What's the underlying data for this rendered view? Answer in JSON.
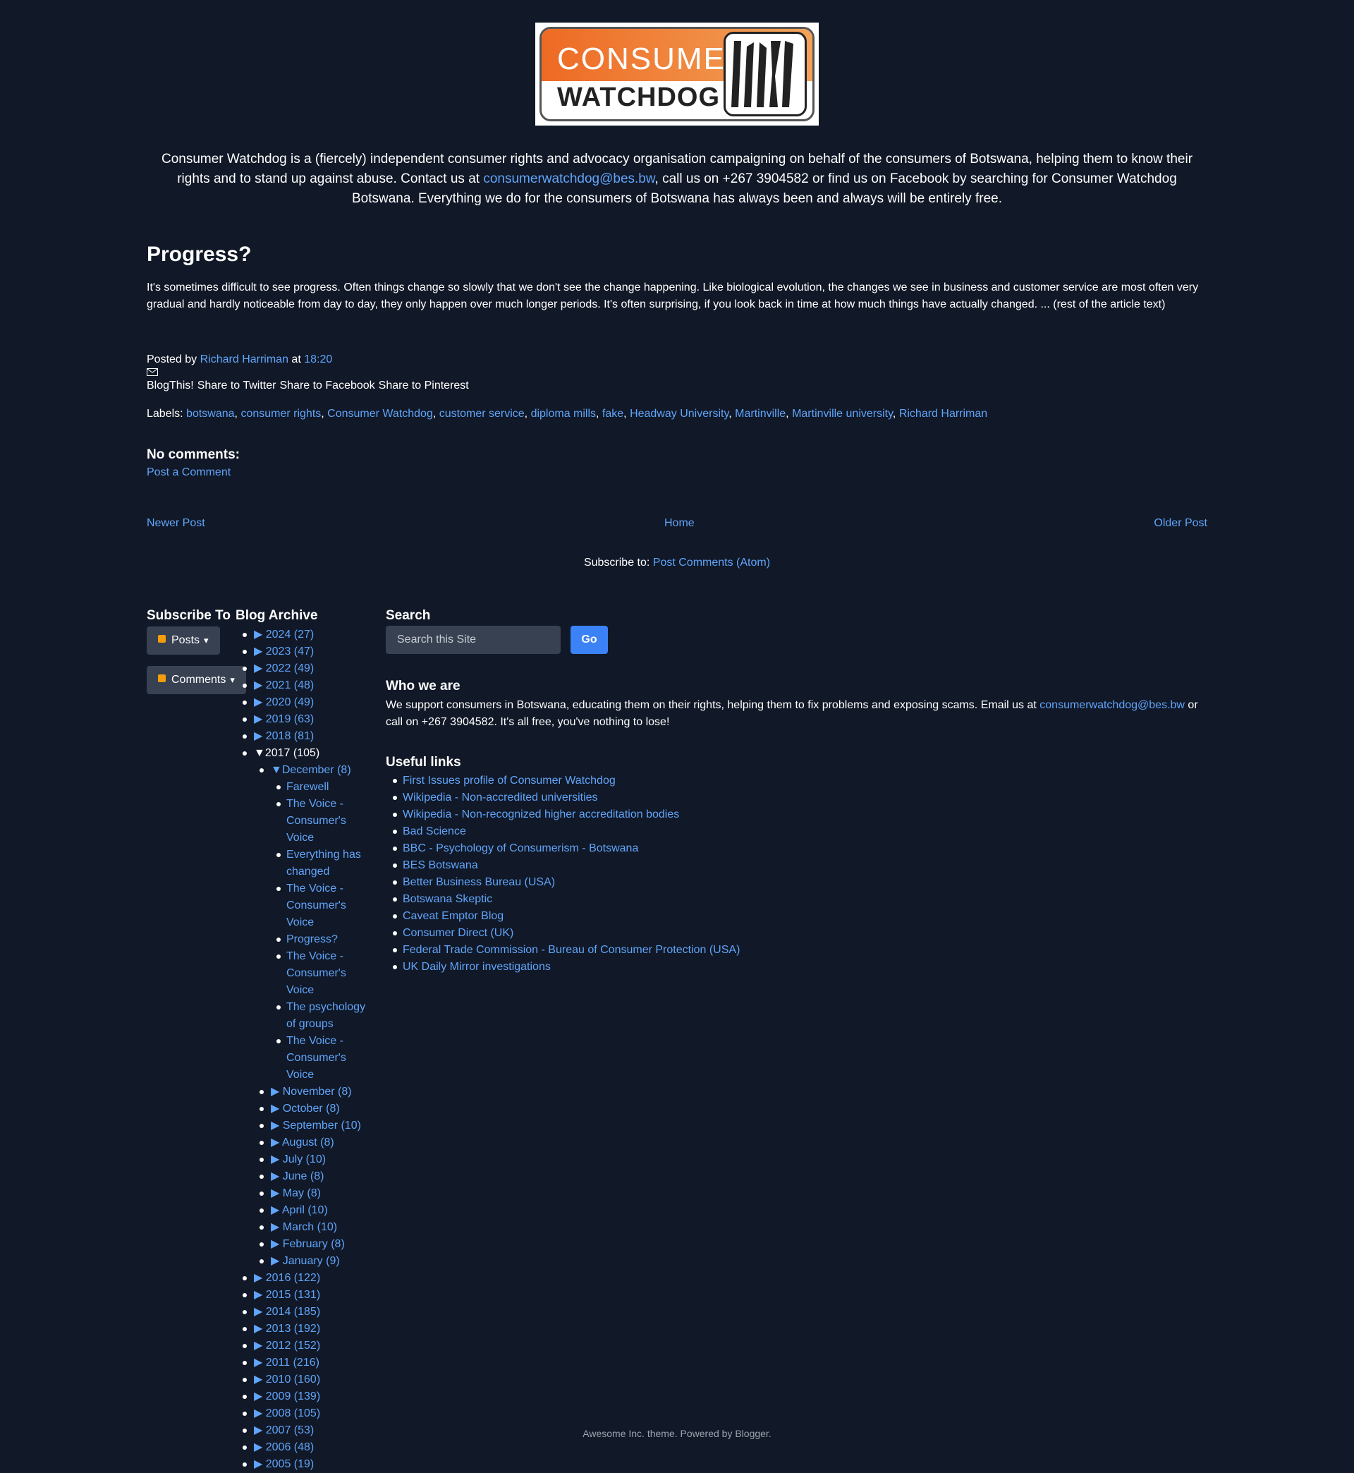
{
  "header": {
    "logo_line1": "CONSUMER",
    "logo_line2": "WATCHDOG",
    "intro_before": "Consumer Watchdog is a (fiercely) independent consumer rights and advocacy organisation campaigning on behalf of the consumers of Botswana, helping them to know their rights and to stand up against abuse. Contact us at ",
    "intro_email": "consumerwatchdog@bes.bw",
    "intro_after": ", call us on +267 3904582 or find us on Facebook by searching for Consumer Watchdog Botswana. Everything we do for the consumers of Botswana has always been and always will be entirely free."
  },
  "post": {
    "title": "Progress?",
    "body": "It's sometimes difficult to see progress. Often things change so slowly that we don't see the change happening. Like biological evolution, the changes we see in business and customer service are most often very gradual and hardly noticeable from day to day, they only happen over much longer periods. It's often surprising, if you look back in time at how much things have actually changed. ... (rest of the article text)",
    "posted_by": "Posted by ",
    "author": "Richard Harriman",
    "at": " at ",
    "time": "18:20",
    "share": [
      "BlogThis!",
      "Share to Twitter",
      "Share to Facebook",
      "Share to Pinterest"
    ],
    "labels_prefix": "Labels: ",
    "labels": [
      "botswana",
      "consumer rights",
      "Consumer Watchdog",
      "customer service",
      "diploma mills",
      "fake",
      "Headway University",
      "Martinville",
      "Martinville university",
      "Richard Harriman"
    ],
    "comments_heading": "No comments:",
    "post_comment": "Post a Comment"
  },
  "nav": {
    "newer": "Newer Post",
    "home": "Home",
    "older": "Older Post",
    "subscribe_prefix": "Subscribe to: ",
    "subscribe_link": "Post Comments (Atom)"
  },
  "subscribe": {
    "title": "Subscribe To",
    "posts": "Posts",
    "comments": "Comments"
  },
  "archive": {
    "title": "Blog Archive",
    "years_before": [
      {
        "label": "2024 (27)"
      },
      {
        "label": "2023 (47)"
      },
      {
        "label": "2022 (49)"
      },
      {
        "label": "2021 (48)"
      },
      {
        "label": "2020 (49)"
      },
      {
        "label": "2019 (63)"
      },
      {
        "label": "2018 (81)"
      }
    ],
    "open_year": "2017 (105)",
    "open_month": "December (8)",
    "december_posts": [
      "Farewell",
      "The Voice - Consumer's Voice",
      "Everything has changed",
      "The Voice - Consumer's Voice",
      "Progress?",
      "The Voice - Consumer's Voice",
      "The psychology of groups",
      "The Voice - Consumer's Voice"
    ],
    "months": [
      "November (8)",
      "October (8)",
      "September (10)",
      "August (8)",
      "July (10)",
      "June (8)",
      "May (8)",
      "April (10)",
      "March (10)",
      "February (8)",
      "January (9)"
    ],
    "years_after": [
      "2016 (122)",
      "2015 (131)",
      "2014 (185)",
      "2013 (192)",
      "2012 (152)",
      "2011 (216)",
      "2010 (160)",
      "2009 (139)",
      "2008 (105)",
      "2007 (53)",
      "2006 (48)",
      "2005 (19)"
    ]
  },
  "search": {
    "title": "Search",
    "placeholder": "Search this Site",
    "button": "Go"
  },
  "who": {
    "title": "Who we are",
    "text_before": "We support consumers in Botswana, educating them on their rights, helping them to fix problems and exposing scams. Email us at ",
    "email": "consumerwatchdog@bes.bw",
    "text_after": " or call on +267 3904582. It's all free, you've nothing to lose!"
  },
  "useful": {
    "title": "Useful links",
    "links": [
      "First Issues profile of Consumer Watchdog",
      "Wikipedia - Non-accredited universities",
      "Wikipedia - Non-recognized higher accreditation bodies",
      "Bad Science",
      "BBC - Psychology of Consumerism - Botswana",
      "BES Botswana",
      "Better Business Bureau (USA)",
      "Botswana Skeptic",
      "Caveat Emptor Blog",
      "Consumer Direct (UK)",
      "Federal Trade Commission - Bureau of Consumer Protection (USA)",
      "UK Daily Mirror investigations"
    ]
  },
  "footer": {
    "text": "Awesome Inc. theme. Powered by ",
    "blogger": "Blogger",
    "period": "."
  },
  "colors": {
    "background": "#111827",
    "link": "#60a5fa",
    "button": "#3b82f6",
    "input": "#374151"
  }
}
